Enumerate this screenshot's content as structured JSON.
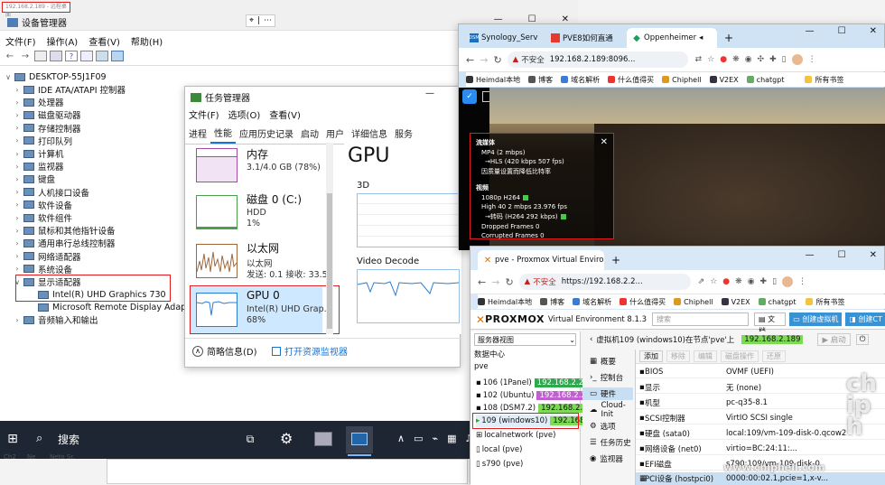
{
  "device_manager": {
    "url_hint": "192.168.2.189 - 远程桌面",
    "title": "设备管理器",
    "window_controls": {
      "minimize": "—",
      "maximize": "☐",
      "close": "✕"
    },
    "toolbar_float": {
      "pin": "⌖",
      "dots": "⋯"
    },
    "menu": [
      "文件(F)",
      "操作(A)",
      "查看(V)",
      "帮助(H)"
    ],
    "root": "DESKTOP-55J1F09",
    "categories": [
      "IDE ATA/ATAPI 控制器",
      "处理器",
      "磁盘驱动器",
      "存储控制器",
      "打印队列",
      "计算机",
      "监视器",
      "键盘",
      "人机接口设备",
      "软件设备",
      "软件组件",
      "鼠标和其他指针设备",
      "通用串行总线控制器",
      "网络适配器",
      "系统设备",
      "显示适配器"
    ],
    "display_children": [
      "Intel(R) UHD Graphics 730",
      "Microsoft Remote Display Adapter"
    ],
    "last_category": "音频输入和输出"
  },
  "taskbar": {
    "search": "搜索",
    "icons": [
      "windows-icon",
      "search-icon",
      "taskview-icon",
      "settings-icon",
      "remote-icon",
      "monitor-icon"
    ],
    "tray": [
      "∧",
      "▭",
      "⌁",
      "▦",
      "♪"
    ],
    "bottom_labels": [
      "Ch2",
      "Ne",
      "Neto Sr."
    ]
  },
  "task_manager": {
    "title": "任务管理器",
    "menu": [
      "文件(F)",
      "选项(O)",
      "查看(V)"
    ],
    "tabs": [
      "进程",
      "性能",
      "应用历史记录",
      "启动",
      "用户",
      "详细信息",
      "服务"
    ],
    "items": [
      {
        "name": "内存",
        "sub": "3.1/4.0 GB (78%)",
        "sub2": ""
      },
      {
        "name": "磁盘 0 (C:)",
        "sub": "HDD",
        "sub2": "1%"
      },
      {
        "name": "以太网",
        "sub": "以太网",
        "sub2": "发送: 0.1  接收: 33.5"
      },
      {
        "name": "GPU 0",
        "sub": "Intel(R) UHD Grap...",
        "sub2": "68%"
      }
    ],
    "gpu_header": "GPU",
    "graph_3d": "3D",
    "graph_decode": "Video Decode",
    "footer_brief": "简略信息(D)",
    "footer_monitor": "打开资源监视器"
  },
  "chrome1": {
    "tabs": [
      "Synology_Serv",
      "PVE8如何直通",
      "Oppenheimer"
    ],
    "insecure": "不安全",
    "url": "192.168.2.189:8096...",
    "bookmarks": [
      "Heimdal本地",
      "博客",
      "域名解析",
      "什么值得买",
      "Chiphell",
      "V2EX",
      "chatgpt"
    ],
    "all_bookmarks": "所有书签",
    "stats": {
      "title": "流媒体",
      "close": "✕",
      "lines": [
        "MP4 (2 mbps)",
        "→HLS (420 kbps 507 fps)",
        "因质量设置而降低比特率"
      ],
      "video_title": "视频",
      "video_lines": [
        "1080p H264",
        "High 40 2 mbps 23.976 fps",
        "→转码 (H264 292 kbps)",
        "Dropped Frames  0",
        "Corrupted Frames  0"
      ]
    }
  },
  "chrome2": {
    "tab": "pve - Proxmox Virtual Environ",
    "insecure": "不安全",
    "url": "https://192.168.2.2...",
    "bookmarks": [
      "Heimdal本地",
      "博客",
      "域名解析",
      "什么值得买",
      "Chiphell",
      "V2EX",
      "chatgpt"
    ],
    "all_bookmarks": "所有书签",
    "pve": {
      "logo": "PROXMOX",
      "env": "Virtual Environment 8.1.3",
      "search": "搜索",
      "docs": "文档",
      "create_vm": "创建虚拟机",
      "create_ct": "创建CT",
      "view": "服务器视图",
      "dc": "数据中心",
      "node": "pve",
      "vms": [
        {
          "label": "106 (1Panel)",
          "ip": "192.168.2.237",
          "color": "#2fa84f"
        },
        {
          "label": "102 (Ubuntu)",
          "ip": "192.168.2.210",
          "color": "#c05fd0"
        },
        {
          "label": "108 (DSM7.2)",
          "ip": "192.168.2.187",
          "color": "#7ed957"
        },
        {
          "label": "109 (windows10)",
          "ip": "192.168.2.189",
          "color": "#7ed957"
        }
      ],
      "storages": [
        "localnetwork (pve)",
        "local (pve)",
        "s790 (pve)"
      ],
      "crumb": "虚拟机109 (windows10)在节点'pve'上",
      "crumb_ip": "192.168.2.189",
      "start": "启动",
      "nav": [
        "概要",
        "控制台",
        "硬件",
        "Cloud-Init",
        "选项",
        "任务历史",
        "监视器"
      ],
      "toolbar": [
        "添加",
        "移除",
        "编辑",
        "磁盘操作",
        "还原"
      ],
      "hw": [
        {
          "k": "BIOS",
          "v": "OVMF (UEFI)"
        },
        {
          "k": "显示",
          "v": "无 (none)"
        },
        {
          "k": "机型",
          "v": "pc-q35-8.1"
        },
        {
          "k": "SCSI控制器",
          "v": "VirtIO SCSI single"
        },
        {
          "k": "硬盘 (sata0)",
          "v": "local:109/vm-109-disk-0.qcow2"
        },
        {
          "k": "网络设备 (net0)",
          "v": "virtio=BC:24:11:..."
        },
        {
          "k": "EFI磁盘",
          "v": "s790:109/vm-109-disk-0"
        },
        {
          "k": "PCI设备 (hostpci0)",
          "v": "0000:00:02.1,pcie=1,x-v..."
        }
      ]
    }
  },
  "watermark": "www.chiphell.com",
  "colors": {
    "highlight_red": "#e21c1c",
    "pve_orange": "#e57000",
    "chrome_blue": "#1a73e8",
    "tm_blue": "#1874d2"
  }
}
